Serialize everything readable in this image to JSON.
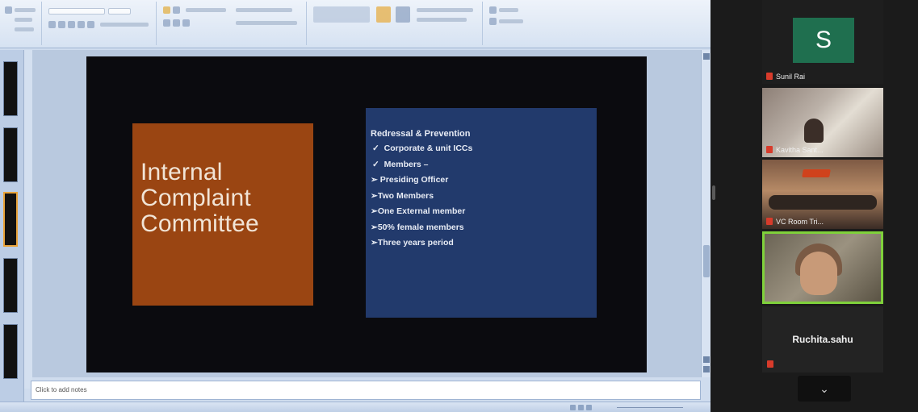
{
  "slide": {
    "title_lines": [
      "Internal",
      "Complaint",
      "Committee"
    ],
    "heading": "Redressal & Prevention",
    "bullets": [
      {
        "marker": "✓",
        "text": "Corporate & unit ICCs"
      },
      {
        "marker": "✓",
        "text": "Members –"
      },
      {
        "marker": "➢",
        "text": "Presiding Officer"
      },
      {
        "marker": "➢",
        "text": "Two Members"
      },
      {
        "marker": "➢",
        "text": "One External member"
      },
      {
        "marker": "➢",
        "text": "50% female members"
      },
      {
        "marker": "➢",
        "text": "Three years period"
      }
    ]
  },
  "notes": {
    "placeholder": "Click to add notes"
  },
  "participants": {
    "p1": {
      "initial": "S",
      "name": "Sunil Rai"
    },
    "p2": {
      "name": "Kavitha Sant..."
    },
    "p3": {
      "name": "VC Room Tri..."
    },
    "p4": {
      "name": "Ruchita.sahu"
    }
  },
  "colors": {
    "title_box": "#9a4512",
    "content_box": "#223a6c",
    "active_speaker_border": "#7fd13b",
    "avatar_bg": "#1f6f4f"
  }
}
